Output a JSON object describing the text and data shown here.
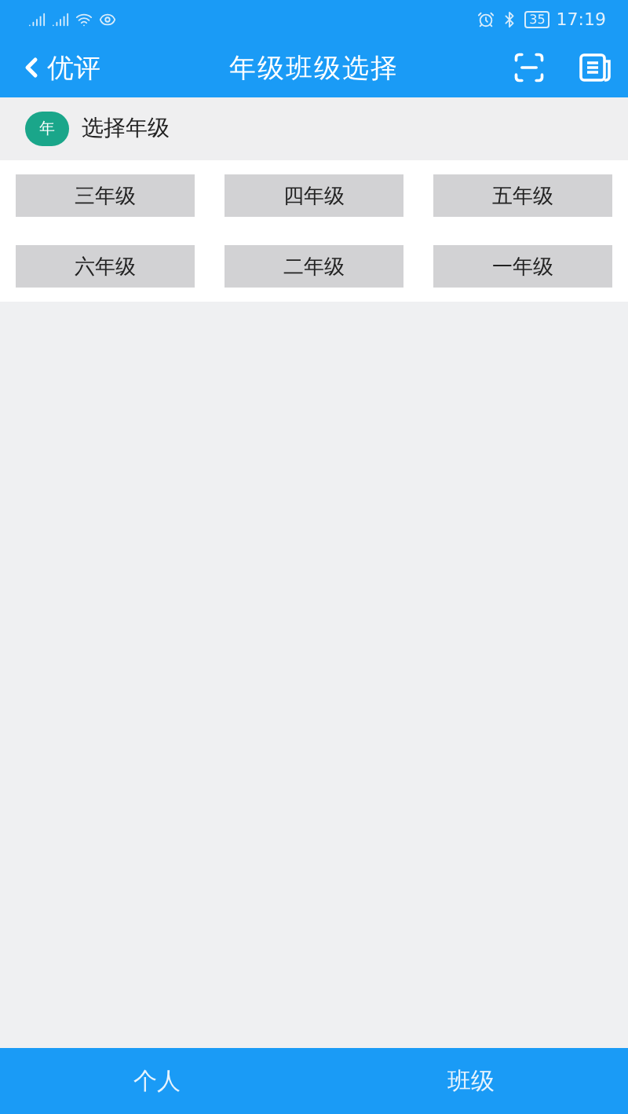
{
  "status_bar": {
    "battery": "35",
    "time": "17:19"
  },
  "header": {
    "back_label": "优评",
    "title": "年级班级选择"
  },
  "section": {
    "badge": "年",
    "title": "选择年级"
  },
  "grades": [
    "三年级",
    "四年级",
    "五年级",
    "六年级",
    "二年级",
    "一年级"
  ],
  "bottom_tabs": [
    "个人",
    "班级"
  ]
}
